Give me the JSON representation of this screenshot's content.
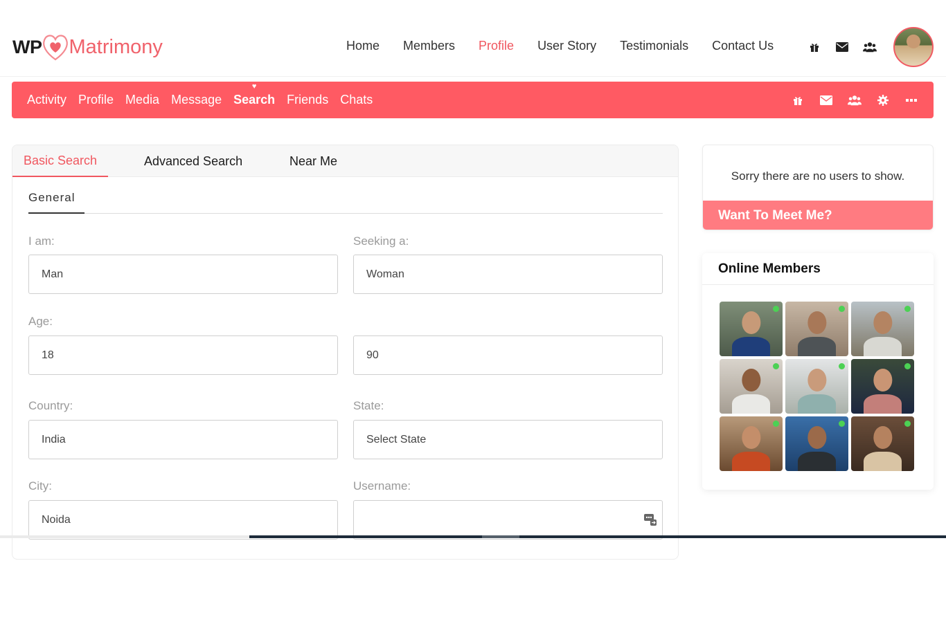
{
  "brand": {
    "wp": "WP",
    "name": "Matrimony",
    "color": "#f0626b"
  },
  "main_nav": [
    {
      "label": "Home",
      "active": false
    },
    {
      "label": "Members",
      "active": false
    },
    {
      "label": "Profile",
      "active": true
    },
    {
      "label": "User Story",
      "active": false
    },
    {
      "label": "Testimonials",
      "active": false
    },
    {
      "label": "Contact Us",
      "active": false
    }
  ],
  "top_icons": [
    "gift-icon",
    "envelope-icon",
    "users-icon"
  ],
  "sub_nav": [
    {
      "label": "Activity",
      "active": false
    },
    {
      "label": "Profile",
      "active": false
    },
    {
      "label": "Media",
      "active": false
    },
    {
      "label": "Message",
      "active": false
    },
    {
      "label": "Search",
      "active": true
    },
    {
      "label": "Friends",
      "active": false
    },
    {
      "label": "Chats",
      "active": false
    }
  ],
  "sub_nav_icons": [
    "gift-icon",
    "envelope-icon",
    "users-icon",
    "gear-icon",
    "ellipsis-icon"
  ],
  "accent_color": "#ff5a63",
  "search": {
    "tabs": [
      "Basic Search",
      "Advanced Search",
      "Near Me"
    ],
    "active_tab": "Basic Search",
    "section": "General",
    "fields": {
      "i_am": {
        "label": "I am:",
        "value": "Man"
      },
      "seeking": {
        "label": "Seeking a:",
        "value": "Woman"
      },
      "age": {
        "label": "Age:",
        "min": "18",
        "max": "90"
      },
      "country": {
        "label": "Country:",
        "value": "India"
      },
      "state": {
        "label": "State:",
        "value": "Select State"
      },
      "city": {
        "label": "City:",
        "value": "Noida"
      },
      "username": {
        "label": "Username:",
        "value": ""
      }
    }
  },
  "sidebar": {
    "no_users_msg": "Sorry there are no users to show.",
    "meet_title": "Want To Meet Me?",
    "online_title": "Online Members",
    "online_count": 9,
    "online_status_color": "#4cd154"
  }
}
